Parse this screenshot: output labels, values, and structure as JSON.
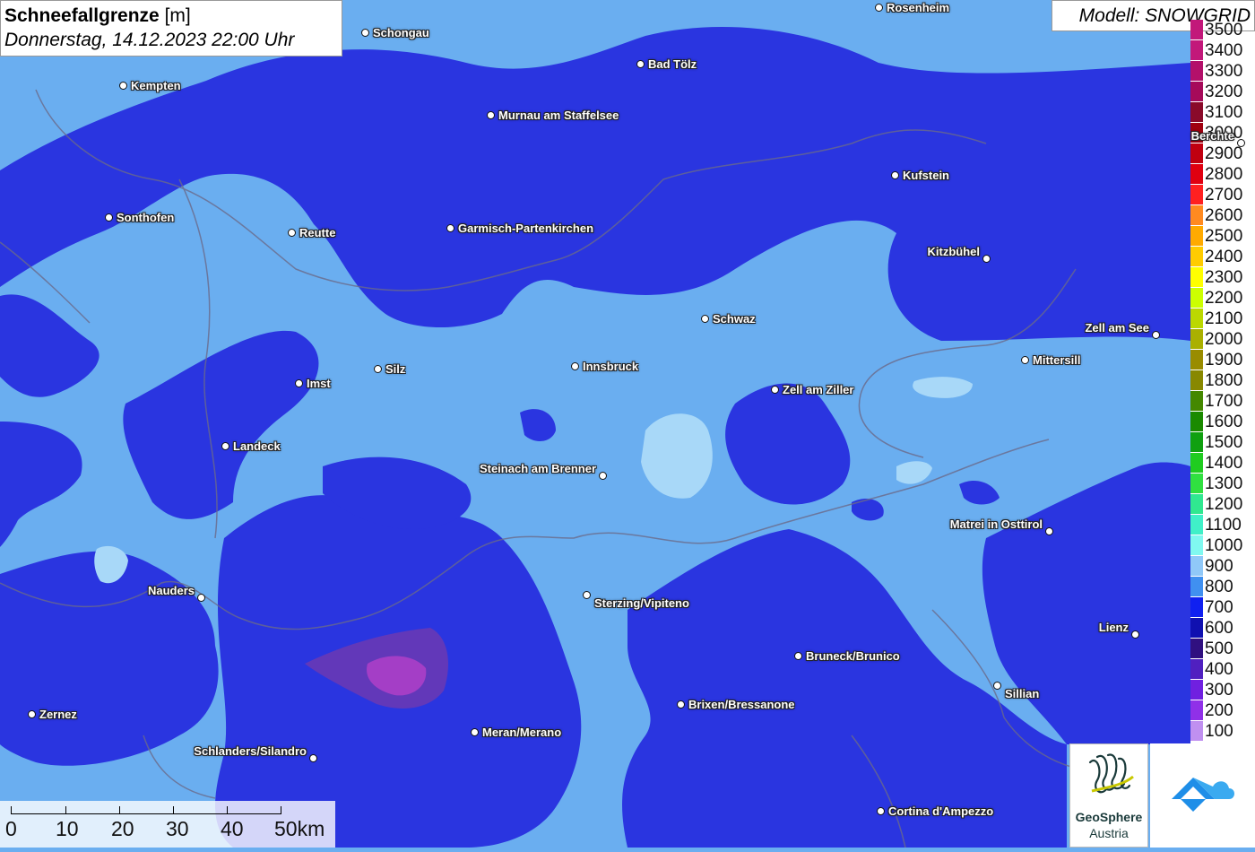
{
  "header": {
    "title_bold": "Schneefallgrenze",
    "title_unit": "[m]",
    "subtitle": "Donnerstag, 14.12.2023 22:00 Uhr",
    "model": "Modell: SNOWGRID"
  },
  "legend": {
    "items": [
      {
        "label": "3500",
        "color": "#c2187a"
      },
      {
        "label": "3400",
        "color": "#c2187a"
      },
      {
        "label": "3300",
        "color": "#b3106a"
      },
      {
        "label": "3200",
        "color": "#a60a5a"
      },
      {
        "label": "3100",
        "color": "#8a0a2a"
      },
      {
        "label": "3000",
        "color": "#a00010"
      },
      {
        "label": "2900",
        "color": "#c00010"
      },
      {
        "label": "2800",
        "color": "#e00010"
      },
      {
        "label": "2700",
        "color": "#ff2020"
      },
      {
        "label": "2600",
        "color": "#ff8a20"
      },
      {
        "label": "2500",
        "color": "#ffaa00"
      },
      {
        "label": "2400",
        "color": "#ffcc00"
      },
      {
        "label": "2300",
        "color": "#ffff00"
      },
      {
        "label": "2200",
        "color": "#ccff00"
      },
      {
        "label": "2100",
        "color": "#bbd800"
      },
      {
        "label": "2000",
        "color": "#aab000"
      },
      {
        "label": "1900",
        "color": "#998c00"
      },
      {
        "label": "1800",
        "color": "#888800"
      },
      {
        "label": "1700",
        "color": "#448800"
      },
      {
        "label": "1600",
        "color": "#1a8a00"
      },
      {
        "label": "1500",
        "color": "#10a010"
      },
      {
        "label": "1400",
        "color": "#20cc20"
      },
      {
        "label": "1300",
        "color": "#30e040"
      },
      {
        "label": "1200",
        "color": "#30e890"
      },
      {
        "label": "1100",
        "color": "#40f0c8"
      },
      {
        "label": "1000",
        "color": "#80f8f0"
      },
      {
        "label": "900",
        "color": "#90c8f8"
      },
      {
        "label": "800",
        "color": "#4090f0"
      },
      {
        "label": "700",
        "color": "#1020f0"
      },
      {
        "label": "600",
        "color": "#1010b0"
      },
      {
        "label": "500",
        "color": "#301080"
      },
      {
        "label": "400",
        "color": "#5020c0"
      },
      {
        "label": "300",
        "color": "#7020e0"
      },
      {
        "label": "200",
        "color": "#9030e8"
      },
      {
        "label": "100",
        "color": "#c090f0"
      }
    ]
  },
  "cities": [
    {
      "name": "Rosenheim"
    },
    {
      "name": "Schongau"
    },
    {
      "name": "Kempten"
    },
    {
      "name": "Bad Tölz"
    },
    {
      "name": "Murnau am Staffelsee"
    },
    {
      "name": "Berchte"
    },
    {
      "name": "Kufstein"
    },
    {
      "name": "Sonthofen"
    },
    {
      "name": "Reutte"
    },
    {
      "name": "Garmisch-Partenkirchen"
    },
    {
      "name": "Kitzbühel"
    },
    {
      "name": "Schwaz"
    },
    {
      "name": "Zell am See"
    },
    {
      "name": "Mittersill"
    },
    {
      "name": "Innsbruck"
    },
    {
      "name": "Silz"
    },
    {
      "name": "Imst"
    },
    {
      "name": "Zell am Ziller"
    },
    {
      "name": "Landeck"
    },
    {
      "name": "Steinach am Brenner"
    },
    {
      "name": "Matrei in Osttirol"
    },
    {
      "name": "Nauders"
    },
    {
      "name": "Sterzing/Vipiteno"
    },
    {
      "name": "Lienz"
    },
    {
      "name": "Bruneck/Brunico"
    },
    {
      "name": "Sillian"
    },
    {
      "name": "Brixen/Bressanone"
    },
    {
      "name": "Zernez"
    },
    {
      "name": "Meran/Merano"
    },
    {
      "name": "Schlanders/Silandro"
    },
    {
      "name": "Cortina d'Ampezzo"
    }
  ],
  "scale": {
    "labels": [
      "0",
      "10",
      "20",
      "30",
      "40",
      "50km"
    ]
  },
  "logos": {
    "geosphere_line1": "GeoSphere",
    "geosphere_line2": "Austria"
  },
  "colors": {
    "low": "#2a35e0",
    "mid": "#6aaef0",
    "high": "#a8d8f8",
    "peak": "#b040c8"
  }
}
